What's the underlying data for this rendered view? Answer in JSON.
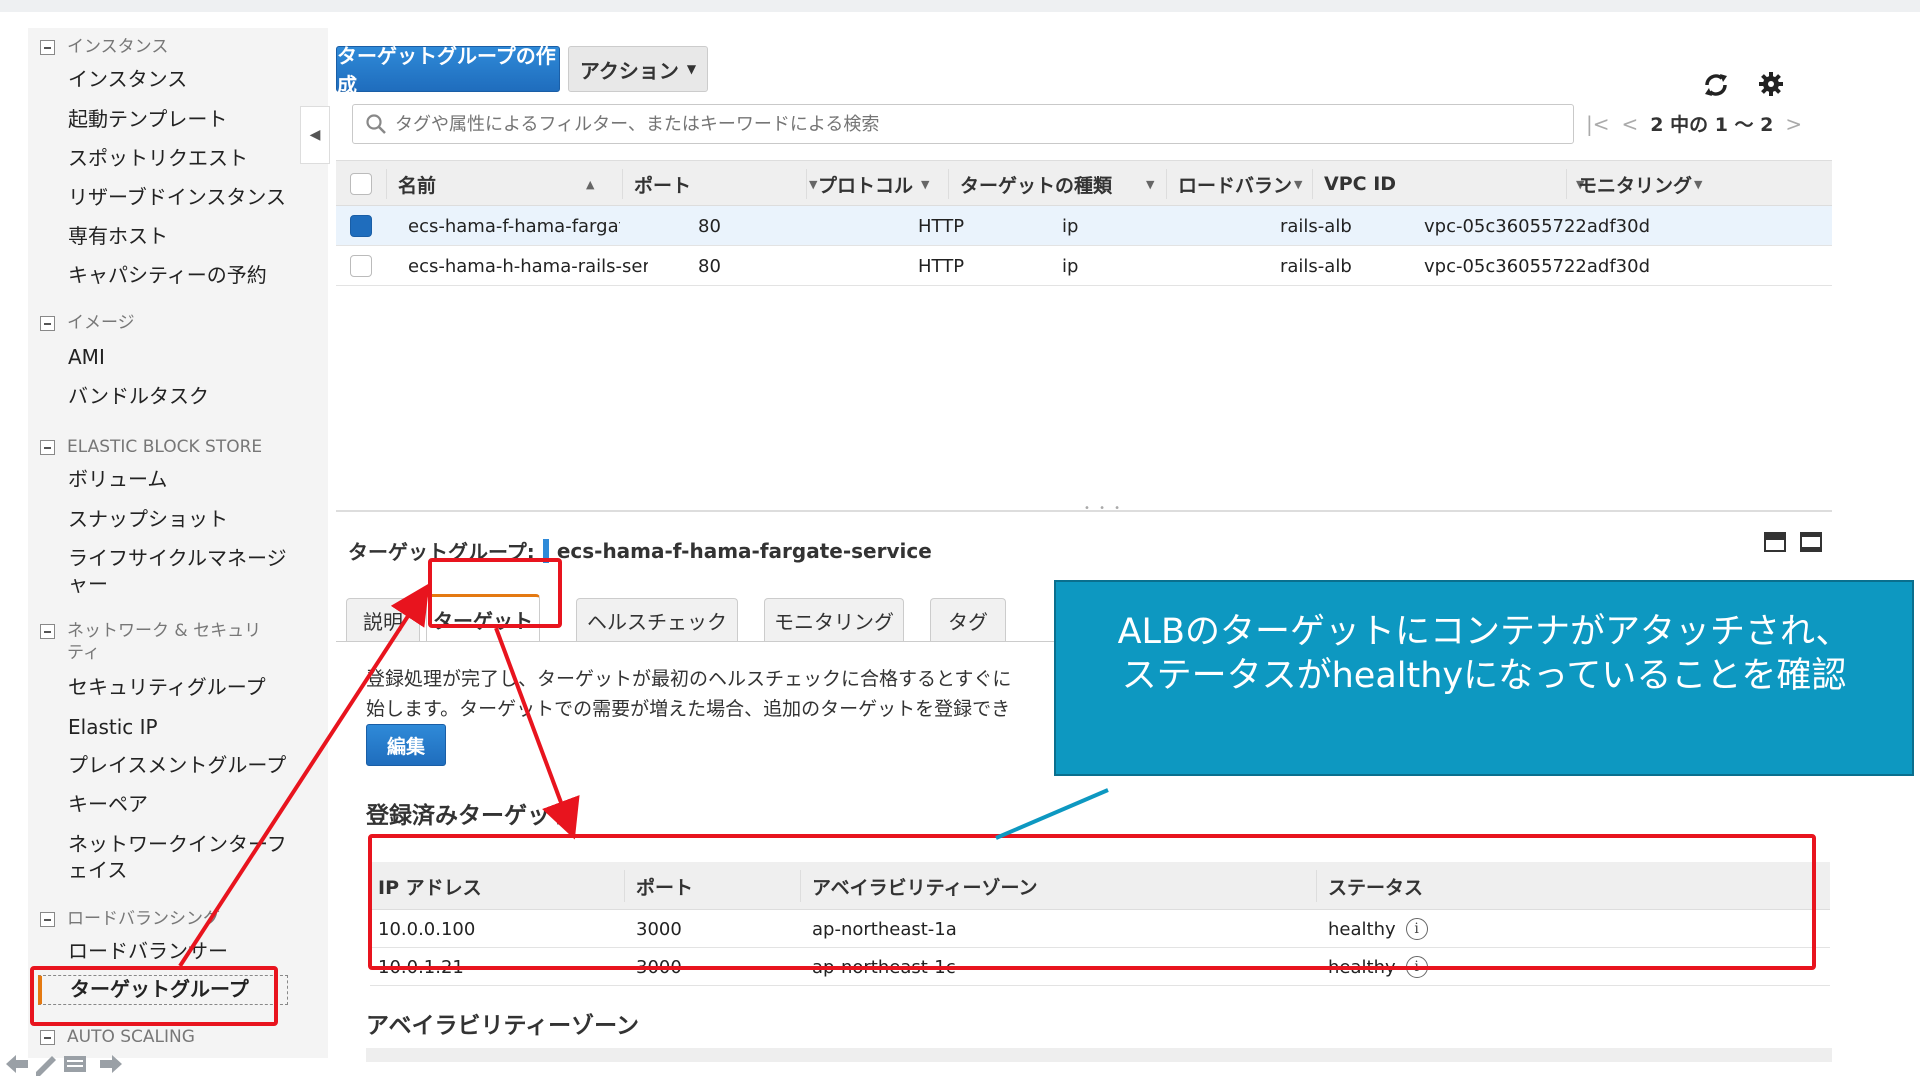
{
  "sidebar": {
    "sections": [
      {
        "header": "インスタンス",
        "items": [
          "インスタンス",
          "起動テンプレート",
          "スポットリクエスト",
          "リザーブドインスタンス",
          "専有ホスト",
          "キャパシティーの予約"
        ]
      },
      {
        "header": "イメージ",
        "items": [
          "AMI",
          "バンドルタスク"
        ]
      },
      {
        "header": "ELASTIC BLOCK STORE",
        "items": [
          "ボリューム",
          "スナップショット",
          "ライフサイクルマネージャー"
        ]
      },
      {
        "header": "ネットワーク & セキュリティ",
        "items": [
          "セキュリティグループ",
          "Elastic IP",
          "プレイスメントグループ",
          "キーペア",
          "ネットワークインターフェイス"
        ]
      },
      {
        "header": "ロードバランシング",
        "items": [
          "ロードバランサー",
          "ターゲットグループ"
        ]
      },
      {
        "header": "AUTO SCALING",
        "items": []
      }
    ]
  },
  "toolbar": {
    "create_label": "ターゲットグループの作成",
    "actions_label": "アクション",
    "search_placeholder": "タグや属性によるフィルター、またはキーワードによる検索",
    "pager_text": "2 中の 1 ～ 2"
  },
  "grid": {
    "columns": [
      "名前",
      "ポート",
      "プロトコル",
      "ターゲットの種類",
      "ロードバラン",
      "VPC ID",
      "モニタリング"
    ],
    "rows": [
      {
        "selected": true,
        "name": "ecs-hama-f-hama-fargate-se…",
        "port": "80",
        "protocol": "HTTP",
        "type": "ip",
        "lb": "rails-alb",
        "vpc": "vpc-05c36055722adf30d"
      },
      {
        "selected": false,
        "name": "ecs-hama-h-hama-rails-service",
        "port": "80",
        "protocol": "HTTP",
        "type": "ip",
        "lb": "rails-alb",
        "vpc": "vpc-05c36055722adf30d"
      }
    ]
  },
  "detail": {
    "title_label": "ターゲットグループ:",
    "title_value": "ecs-hama-f-hama-fargate-service",
    "tabs": [
      "説明",
      "ターゲット",
      "ヘルスチェック",
      "モニタリング",
      "タグ"
    ],
    "desc_line1": "登録処理が完了し、ターゲットが最初のヘルスチェックに合格するとすぐに",
    "desc_line2": "始します。ターゲットでの需要が増えた場合、追加のターゲットを登録でき",
    "edit_label": "編集",
    "registered_title": "登録済みターゲット",
    "targets_columns": [
      "IP アドレス",
      "ポート",
      "アベイラビリティーゾーン",
      "ステータス"
    ],
    "targets": [
      {
        "ip": "10.0.0.100",
        "port": "3000",
        "az": "ap-northeast-1a",
        "status": "healthy"
      },
      {
        "ip": "10.0.1.21",
        "port": "3000",
        "az": "ap-northeast-1c",
        "status": "healthy"
      }
    ],
    "az_title": "アベイラビリティーゾーン"
  },
  "annotation": {
    "line1": "ALBのターゲットにコンテナがアタッチされ、",
    "line2": "ステータスがhealthyになっていることを確認"
  },
  "colors": {
    "accent": "#1f6dbd",
    "annotation_red": "#e8141e",
    "callout_bg": "#0d98c1",
    "active_orange": "#e47911"
  }
}
